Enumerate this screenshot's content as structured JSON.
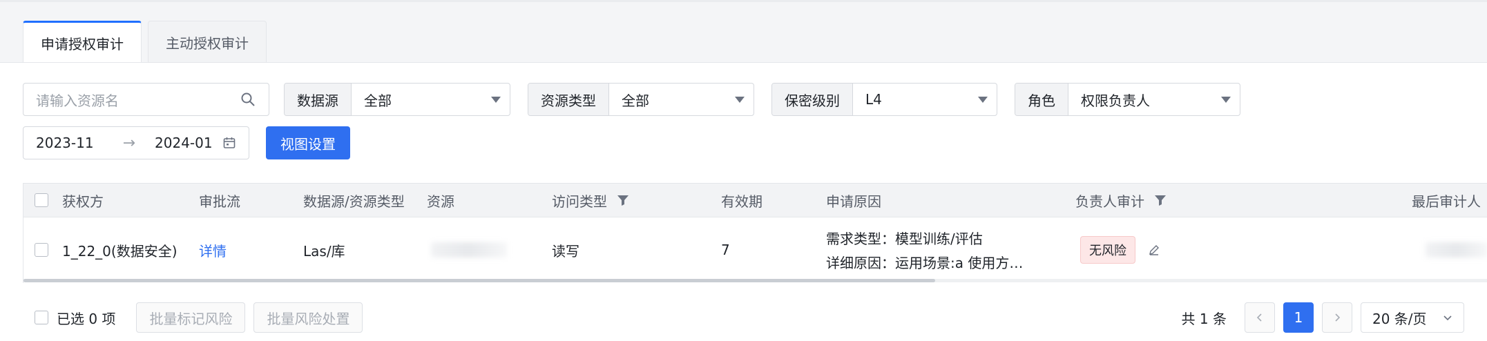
{
  "tabs": [
    {
      "label": "申请授权审计",
      "active": true
    },
    {
      "label": "主动授权审计",
      "active": false
    }
  ],
  "search": {
    "placeholder": "请输入资源名"
  },
  "filters": [
    {
      "label": "数据源",
      "value": "全部"
    },
    {
      "label": "资源类型",
      "value": "全部"
    },
    {
      "label": "保密级别",
      "value": "L4"
    },
    {
      "label": "角色",
      "value": "权限负责人"
    }
  ],
  "daterange": {
    "start": "2023-11",
    "arrow": "→",
    "end": "2024-01"
  },
  "view_button": "视图设置",
  "table": {
    "headers": {
      "grantee": "获权方",
      "approval": "审批流",
      "source_type": "数据源/资源类型",
      "resource": "资源",
      "access": "访问类型",
      "validity": "有效期",
      "reason": "申请原因",
      "owner_audit": "负责人审计",
      "last_auditor": "最后审计人"
    },
    "rows": [
      {
        "grantee": "1_22_0(数据安全)",
        "approval": "详情",
        "source_type": "Las/库",
        "access": "读写",
        "validity": "7",
        "reason_line1": "需求类型：模型训练/评估",
        "reason_line2": "详细原因：运用场景:a 使用方…",
        "risk": "无风险"
      }
    ]
  },
  "footer": {
    "selected": "已选 0 项",
    "batch_mark": "批量标记风险",
    "batch_handle": "批量风险处置",
    "total": "共 1 条",
    "current_page": "1",
    "page_size": "20 条/页"
  },
  "colors": {
    "accent": "#2f6ff0",
    "risk_badge_bg": "#fde7e7"
  }
}
